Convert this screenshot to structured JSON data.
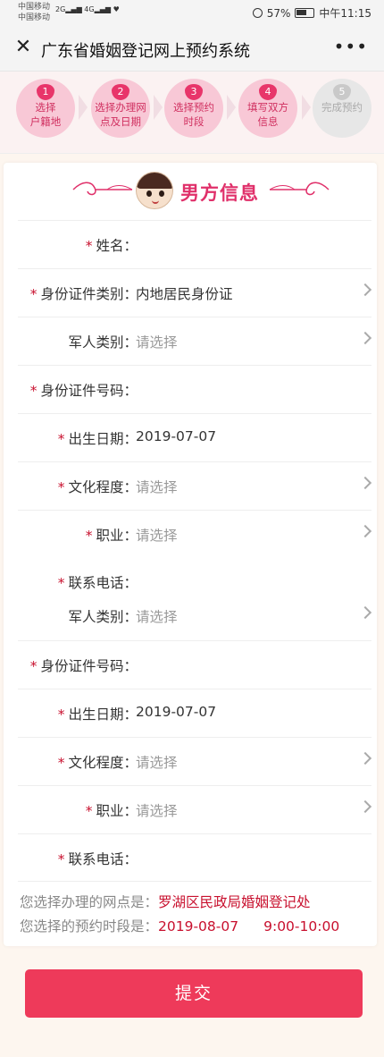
{
  "status_bar": {
    "carrier_1": "中国移动",
    "carrier_2": "中国移动",
    "network_1": "2G",
    "network_2": "4G",
    "battery": "57%",
    "time": "中午11:15"
  },
  "title_bar": {
    "title": "广东省婚姻登记网上预约系统",
    "close_icon": "close-icon",
    "more_icon": "more-icon"
  },
  "steps": [
    {
      "num": "1",
      "line1": "选择",
      "line2": "户籍地"
    },
    {
      "num": "2",
      "line1": "选择办理网",
      "line2": "点及日期"
    },
    {
      "num": "3",
      "line1": "选择预约",
      "line2": "时段"
    },
    {
      "num": "4",
      "line1": "填写双方",
      "line2": "信息"
    },
    {
      "num": "5",
      "line1": "完成预约",
      "line2": ""
    }
  ],
  "section": {
    "title": "男方信息"
  },
  "form": {
    "rows": [
      {
        "label": "姓名：",
        "required": "*",
        "value": ""
      },
      {
        "label": "身份证件类别：",
        "required": "*",
        "value": "内地居民身份证"
      },
      {
        "label": "军人类别：",
        "required": "",
        "value": "请选择"
      },
      {
        "label": "身份证件号码：",
        "required": "*",
        "value": ""
      },
      {
        "label": "出生日期：",
        "required": "*",
        "value": "2019-07-07"
      },
      {
        "label": "文化程度：",
        "required": "*",
        "value": "请选择"
      },
      {
        "label": "职业：",
        "required": "*",
        "value": "请选择"
      },
      {
        "label": "联系电话：",
        "required": "*",
        "value": ""
      },
      {
        "label": "军人类别：",
        "required": "",
        "value": "请选择"
      },
      {
        "label": "身份证件号码：",
        "required": "*",
        "value": ""
      },
      {
        "label": "出生日期：",
        "required": "*",
        "value": "2019-07-07"
      },
      {
        "label": "文化程度：",
        "required": "*",
        "value": "请选择"
      },
      {
        "label": "职业：",
        "required": "*",
        "value": "请选择"
      },
      {
        "label": "联系电话：",
        "required": "*",
        "value": ""
      }
    ]
  },
  "summary": {
    "office_label": "您选择办理的网点是：",
    "office_value": "罗湖区民政局婚姻登记处",
    "time_label": "您选择的预约时段是：",
    "date_value": "2019-08-07",
    "time_value": "9:00-10:00"
  },
  "submit_label": "提交",
  "colors": {
    "accent": "#e0306a",
    "required": "#c8102e",
    "submit": "#ee3a5a",
    "step_bg": "#f8c8d6"
  }
}
